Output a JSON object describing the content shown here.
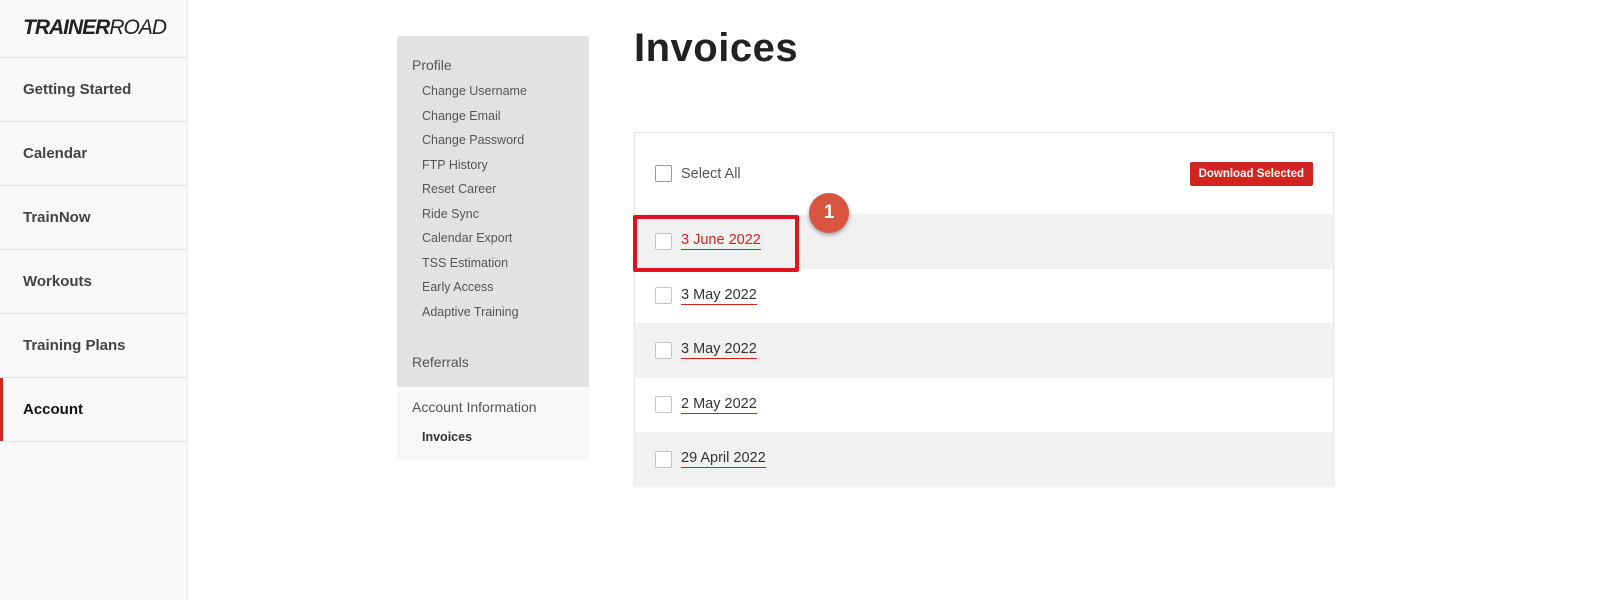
{
  "brand": {
    "logo_bold": "TRAINER",
    "logo_regular": "ROAD"
  },
  "nav": {
    "items": [
      {
        "label": "Getting Started"
      },
      {
        "label": "Calendar"
      },
      {
        "label": "TrainNow"
      },
      {
        "label": "Workouts"
      },
      {
        "label": "Training Plans"
      },
      {
        "label": "Account",
        "active": true
      }
    ]
  },
  "settings": {
    "profile_heading": "Profile",
    "profile_items": [
      "Change Username",
      "Change Email",
      "Change Password",
      "FTP History",
      "Reset Career",
      "Ride Sync",
      "Calendar Export",
      "TSS Estimation",
      "Early Access",
      "Adaptive Training"
    ],
    "referrals_heading": "Referrals",
    "account_heading": "Account Information",
    "account_items": [
      "Invoices"
    ]
  },
  "main": {
    "title": "Invoices",
    "select_all_label": "Select All",
    "download_label": "Download Selected",
    "invoices": [
      {
        "date": "3 June 2022"
      },
      {
        "date": "3 May 2022"
      },
      {
        "date": "3 May 2022"
      },
      {
        "date": "2 May 2022"
      },
      {
        "date": "29 April 2022"
      }
    ]
  },
  "annotation": {
    "badge": "1"
  },
  "colors": {
    "accent": "#d0251e",
    "highlight": "#e0121c",
    "badge": "#d9553f"
  }
}
